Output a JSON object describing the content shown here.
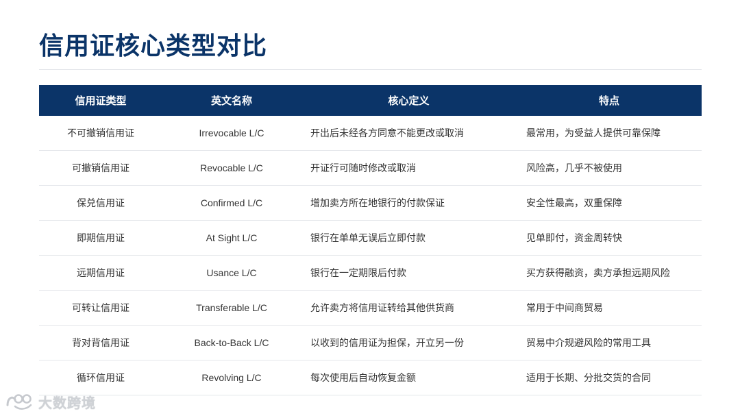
{
  "title": "信用证核心类型对比",
  "table": {
    "headers": [
      "信用证类型",
      "英文名称",
      "核心定义",
      "特点"
    ],
    "rows": [
      [
        "不可撤销信用证",
        "Irrevocable L/C",
        "开出后未经各方同意不能更改或取消",
        "最常用，为受益人提供可靠保障"
      ],
      [
        "可撤销信用证",
        "Revocable L/C",
        "开证行可随时修改或取消",
        "风险高，几乎不被使用"
      ],
      [
        "保兑信用证",
        "Confirmed L/C",
        "增加卖方所在地银行的付款保证",
        "安全性最高，双重保障"
      ],
      [
        "即期信用证",
        "At Sight L/C",
        "银行在单单无误后立即付款",
        "见单即付，资金周转快"
      ],
      [
        "远期信用证",
        "Usance L/C",
        "银行在一定期限后付款",
        "买方获得融资，卖方承担远期风险"
      ],
      [
        "可转让信用证",
        "Transferable L/C",
        "允许卖方将信用证转给其他供货商",
        "常用于中间商贸易"
      ],
      [
        "背对背信用证",
        "Back-to-Back L/C",
        "以收到的信用证为担保，开立另一份",
        "贸易中介规避风险的常用工具"
      ],
      [
        "循环信用证",
        "Revolving L/C",
        "每次使用后自动恢复金额",
        "适用于长期、分批交货的合同"
      ]
    ]
  },
  "watermark": {
    "text": "大数跨境"
  },
  "colors": {
    "title": "#0b3468",
    "header_bg": "#0b3468",
    "header_text": "#ffffff",
    "row_divider": "#e3e6ea"
  }
}
